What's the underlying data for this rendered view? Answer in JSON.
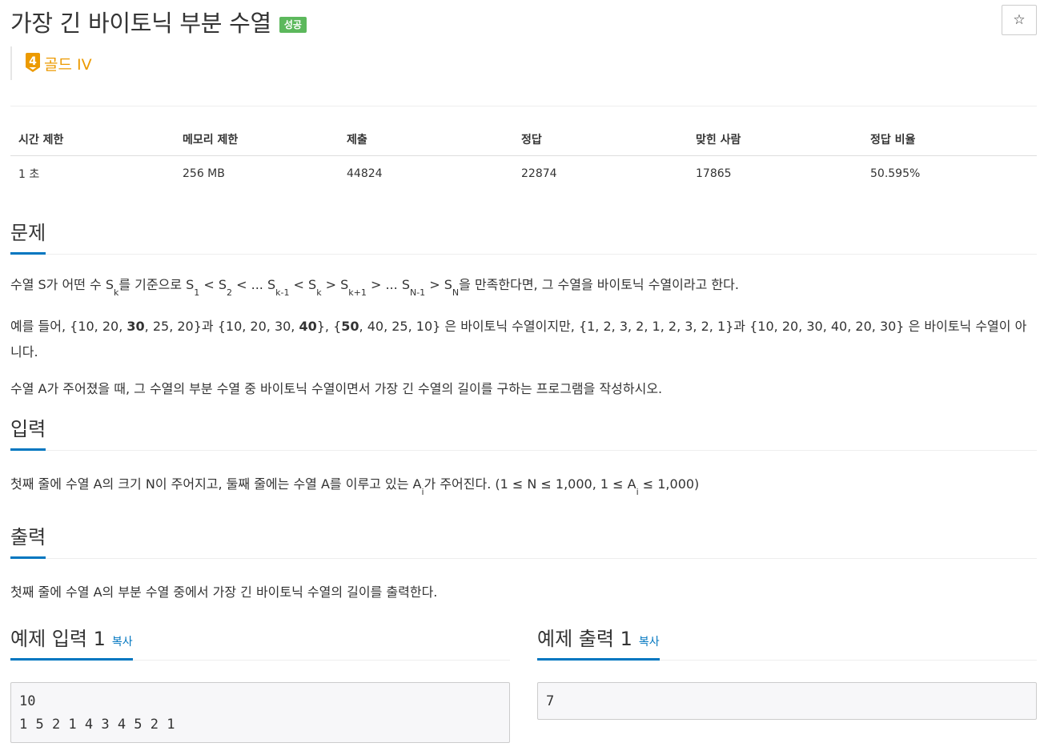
{
  "header": {
    "title": "가장 긴 바이토닉 부분 수열",
    "status_badge": "성공",
    "star": "☆",
    "tier_number": "4",
    "tier_label": "골드 IV",
    "tier_color": "#ec9a00"
  },
  "stats": {
    "headers": [
      "시간 제한",
      "메모리 제한",
      "제출",
      "정답",
      "맞힌 사람",
      "정답 비율"
    ],
    "values": [
      "1 초",
      "256 MB",
      "44824",
      "22874",
      "17865",
      "50.595%"
    ]
  },
  "problem": {
    "heading": "문제",
    "p1": {
      "a": "수열 S가 어떤 수 S",
      "k1": "k",
      "b": "를 기준으로 S",
      "s1": "1",
      "c": " < S",
      "s2": "2",
      "d": " < ... S",
      "km1": "k-1",
      "e": " < S",
      "k2": "k",
      "f": " > S",
      "kp1": "k+1",
      "g": " > ... S",
      "nm1": "N-1",
      "h": " > S",
      "n": "N",
      "i": "을 만족한다면, 그 수열을 바이토닉 수열이라고 한다."
    },
    "p2": {
      "a": "예를 들어, {10, 20, ",
      "b1": "30",
      "b": ", 25, 20}과 {10, 20, 30, ",
      "b2": "40",
      "c": "}, {",
      "b3": "50",
      "d": ", 40, 25, 10} 은 바이토닉 수열이지만,  {1, 2, 3, 2, 1, 2, 3, 2, 1}과 {10, 20, 30, 40, 20, 30} 은 바이토닉 수열이 아니다."
    },
    "p3": "수열 A가 주어졌을 때, 그 수열의 부분 수열 중 바이토닉 수열이면서 가장 긴 수열의 길이를 구하는 프로그램을 작성하시오."
  },
  "input": {
    "heading": "입력",
    "a": "첫째 줄에 수열 A의 크기 N이 주어지고, 둘째 줄에는 수열 A를 이루고 있는 A",
    "i1": "i",
    "b": "가 주어진다. (1 ≤ N ≤ 1,000, 1 ≤ A",
    "i2": "i",
    "c": " ≤ 1,000)"
  },
  "output": {
    "heading": "출력",
    "text": "첫째 줄에 수열 A의 부분 수열 중에서 가장 긴 바이토닉 수열의 길이를 출력한다."
  },
  "examples": {
    "copy_label": "복사",
    "input_heading": "예제 입력 1",
    "input_text": "10\n1 5 2 1 4 3 4 5 2 1",
    "output_heading": "예제 출력 1",
    "output_text": "7"
  },
  "colors": {
    "accent": "#0076c0",
    "success": "#5cb85c",
    "gold": "#ec9a00"
  }
}
